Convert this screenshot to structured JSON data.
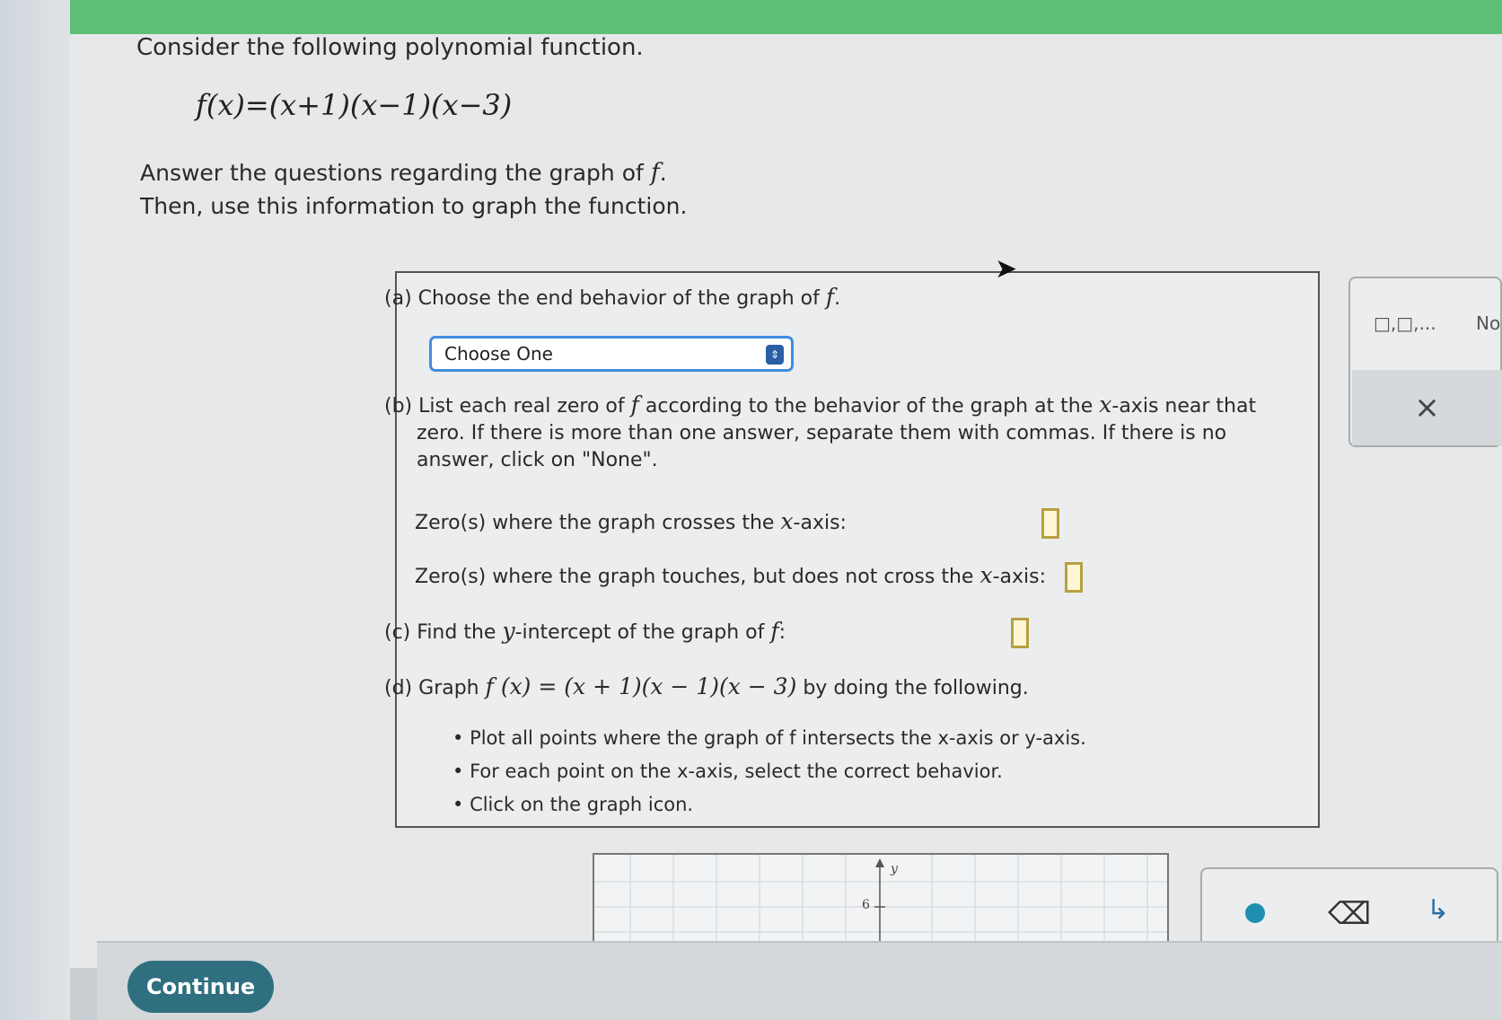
{
  "prompt": "Consider the following polynomial function.",
  "formula": "f(x)=(x+1)(x−1)(x−3)",
  "instructions": {
    "line1_prefix": "Answer the questions regarding the graph of ",
    "line1_var": "f",
    "line1_suffix": ".",
    "line2": "Then, use this information to graph the function."
  },
  "questions": {
    "a": {
      "label": "(a)",
      "text": "Choose the end behavior of the graph of ",
      "var": "f",
      "suffix": ".",
      "select_value": "Choose One"
    },
    "b": {
      "label": "(b)",
      "text_line1_prefix": "List each real zero of ",
      "text_line1_var": "f",
      "text_line1_mid": " according to the behavior of the graph at the ",
      "text_line1_axis": "x",
      "text_line1_suffix": "-axis near that",
      "text_line2": "zero. If there is more than one answer, separate them with commas. If there is no",
      "text_line3": "answer, click on \"None\".",
      "crosses_prefix": "Zero(s) where the graph crosses the ",
      "crosses_axis": "x",
      "crosses_suffix": "-axis:",
      "touches_prefix": "Zero(s) where the graph touches, but does not cross the ",
      "touches_axis": "x",
      "touches_suffix": "-axis:"
    },
    "c": {
      "label": "(c)",
      "text_prefix": "Find the ",
      "axis": "y",
      "text_mid": "-intercept of the graph of ",
      "var": "f",
      "suffix": ":"
    },
    "d": {
      "label": "(d)",
      "text_prefix": "Graph ",
      "formula": "f (x) = (x + 1)(x − 1)(x − 3)",
      "text_suffix": " by doing the following.",
      "bullets": [
        "Plot all points where the graph of f intersects the x-axis or y-axis.",
        "For each point on the x-axis, select the correct behavior.",
        "Click on the graph icon."
      ]
    }
  },
  "side_panel": {
    "chips": "□,□,...",
    "none_label": "No",
    "close_symbol": "×"
  },
  "graph": {
    "axis_label_y": "y",
    "tick_label": "6"
  },
  "tools": {
    "eraser": "⌫",
    "curve": "↳"
  },
  "continue_label": "Continue",
  "colors": {
    "top_bar": "#5cbf73",
    "select_border": "#3f8dde",
    "continue_bg": "#2f6f80",
    "answer_box_border": "#b8a040"
  }
}
